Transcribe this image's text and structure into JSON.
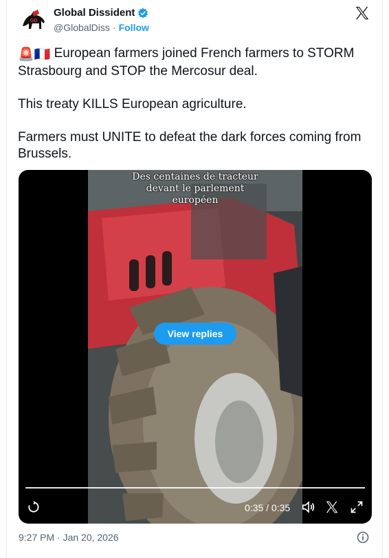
{
  "author": {
    "display_name": "Global Dissident",
    "handle": "@GlobalDiss",
    "separator": "·",
    "follow_label": "Follow"
  },
  "tweet": {
    "line1_emoji": "🚨🇫🇷",
    "paragraph1": "European farmers joined French farmers to STORM Strasbourg and STOP the Mercosur deal.",
    "paragraph2": "This treaty KILLS European agriculture.",
    "paragraph3": "Farmers must UNITE to defeat the dark forces coming from Brussels."
  },
  "video": {
    "caption_lines": [
      "Des centaines de tracteur",
      "devant le parlement",
      "européen"
    ],
    "view_replies_label": "View replies",
    "time": "0:35 / 0:35",
    "progress": 1.0
  },
  "footer": {
    "timestamp": "9:27 PM · Jan 20, 2026"
  },
  "icons": {
    "verified": "verified-badge-icon",
    "x_logo": "x-logo-icon",
    "replay": "replay-icon",
    "volume": "volume-icon",
    "fullscreen": "fullscreen-icon",
    "info": "info-icon"
  },
  "colors": {
    "accent": "#1d9bf0",
    "text": "#0f1419",
    "muted": "#536471",
    "tractor_red": "#c0303a"
  }
}
